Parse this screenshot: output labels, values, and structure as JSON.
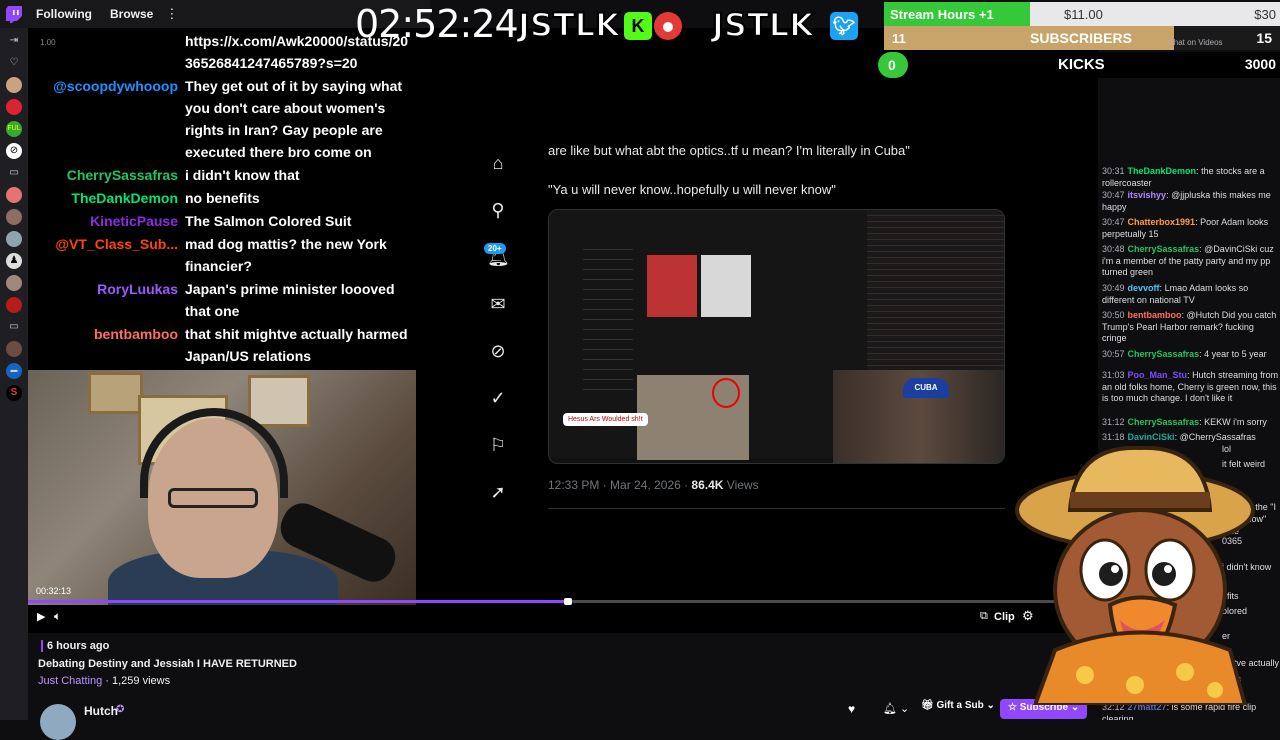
{
  "nav": {
    "following": "Following",
    "browse": "Browse",
    "more": "⋮"
  },
  "overlay": {
    "timer": "02:52:24",
    "brand1": "JSTLK",
    "brand2": "JSTLK",
    "k_icon": "K",
    "stream_hours": "Stream Hours +1",
    "money_mid": "$11.00",
    "money_right": "$30",
    "subs_count": "11",
    "subs_label": "SUBSCRIBERS",
    "subs_goal": "15",
    "chat_on_videos": "Chat on Videos",
    "kicks_count": "0",
    "kicks_label": "KICKS",
    "kicks_goal": "3000",
    "zoom": "1.00"
  },
  "overlay_chat": [
    {
      "user": "",
      "color": "#ffffff",
      "lines": [
        "https://x.com/Awk20000/status/20",
        "36526841247465789?s=20"
      ]
    },
    {
      "user": "@scoopdywhooop",
      "color": "#1e90ff",
      "lines": [
        "They get out of it by saying what",
        "you don't care about women's",
        "rights in Iran? Gay people are",
        "executed there bro come on"
      ]
    },
    {
      "user": "CherrySassafras",
      "color": "#22c55e",
      "lines": [
        "i didn't know that"
      ]
    },
    {
      "user": "TheDankDemon",
      "color": "#00e676",
      "lines": [
        "no benefits"
      ]
    },
    {
      "user": "KineticPause",
      "color": "#8a2be2",
      "lines": [
        "The Salmon Colored Suit"
      ]
    },
    {
      "user": "@VT_Class_Sub...",
      "color": "#ff4500",
      "lines": [
        "mad dog mattis? the new York",
        "financier?"
      ]
    },
    {
      "user": "RoryLuukas",
      "color": "#9b59ff",
      "lines": [
        "Japan's prime minister loooved",
        "that one"
      ]
    },
    {
      "user": "bentbamboo",
      "color": "#ff6f61",
      "lines": [
        "that shit mightve actually harmed",
        "Japan/US relations"
      ]
    }
  ],
  "tweet": {
    "text1": "are like but what abt the optics..tf u mean? I'm literally in Cuba\"",
    "text2": "\"Ya u will never know..hopefully u will never know\"",
    "meta_time": "12:33 PM · Mar 24, 2026 ·",
    "meta_views": "86.4K",
    "meta_views_label": "Views",
    "notif_badge": "20+",
    "cap_hat": "CUBA",
    "img_caption": "Hesus Ars Woulded sh!t"
  },
  "player": {
    "time": "00:32:13",
    "progress": 0.505,
    "clip_label": "Clip"
  },
  "video_info": {
    "ago": "6 hours ago",
    "title": "Debating Destiny and Jessiah I HAVE RETURNED",
    "category": "Just Chatting",
    "views": "· 1,259 views"
  },
  "channel": {
    "name": "Hutch",
    "gift_label": "Gift a Sub",
    "subscribe_label": "Subscribe"
  },
  "chat": [
    {
      "time": "30:31",
      "user": "TheDankDemon",
      "color": "#00e676",
      "msg": "the stocks are a rollercoaster"
    },
    {
      "time": "30:47",
      "user": "itsvishyy",
      "color": "#b388ff",
      "msg": "@jjpluska this makes me happy"
    },
    {
      "time": "30:47",
      "user": "Chatterbox1991",
      "color": "#ff9f43",
      "msg": "Poor Adam looks perpetually 15"
    },
    {
      "time": "30:48",
      "user": "CherrySassafras",
      "color": "#22c55e",
      "msg": "@DavinCiSki cuz i'm a member of the patty party and my pp turned green"
    },
    {
      "time": "30:49",
      "user": "devvoff",
      "color": "#4fc3f7",
      "msg": "Lmao Adam looks so different on national TV"
    },
    {
      "time": "30:50",
      "user": "bentbamboo",
      "color": "#ff6f61",
      "msg": "@Hutch Did you catch Trump's Pearl Harbor remark? fucking cringe"
    },
    {
      "time": "30:57",
      "user": "CherrySassafras",
      "color": "#22c55e",
      "msg": "4 year to 5 year"
    },
    {
      "time": "31:03",
      "user": "Poo_Man_Stu",
      "color": "#7c4dff",
      "msg": "Hutch streaming from an old folks home, Cherry is green now, this is too much change. I don't like it"
    },
    {
      "time": "31:12",
      "user": "CherrySassafras",
      "color": "#22c55e",
      "msg": "KEKW i'm sorry"
    },
    {
      "time": "31:18",
      "user": "DavinCiSki",
      "color": "#26a69a",
      "msg": "@CherrySassafras"
    },
    {
      "time": "",
      "user": "",
      "color": "#ffffff",
      "msg": "lol"
    },
    {
      "time": "",
      "user": "",
      "color": "#ffffff",
      "msg": "it felt weird"
    },
    {
      "time": "",
      "user": "",
      "color": "#ffffff",
      "msg": "'s doing the \"I"
    },
    {
      "time": "",
      "user": "",
      "color": "#ffffff",
      "msg": "ever know\""
    },
    {
      "time": "",
      "user": "",
      "color": "#ffffff",
      "msg": "time"
    },
    {
      "time": "",
      "user": "",
      "color": "#ffffff",
      "msg": "0365"
    },
    {
      "time": "",
      "user": "",
      "color": "#ffffff",
      "msg": "i didn't know"
    },
    {
      "time": "",
      "user": "",
      "color": "#ffffff",
      "msg": "efits"
    },
    {
      "time": "",
      "user": "",
      "color": "#ffffff",
      "msg": "olored"
    },
    {
      "time": "",
      "user": "",
      "color": "#ffffff",
      "msg": "er"
    },
    {
      "time": "",
      "user": "",
      "color": "#ffffff",
      "msg": "ly"
    },
    {
      "time": "",
      "user": "",
      "color": "#ffffff",
      "msg": "ightve actually"
    },
    {
      "time": "",
      "user": "",
      "color": "#ffffff",
      "msg": "tions"
    },
    {
      "time": "",
      "user": "",
      "color": "#ffffff",
      "msg": "na"
    },
    {
      "time": "32:12",
      "user": "27matt27",
      "color": "#5c6bc0",
      "msg": "is some rapid fire clip clearing"
    }
  ],
  "colors": {
    "twitch_purple": "#9147ff",
    "kick_green": "#53fc18",
    "bg": "#0e0e10"
  }
}
